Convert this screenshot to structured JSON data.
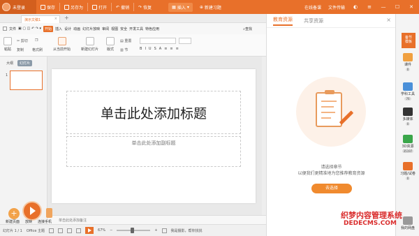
{
  "titlebar": {
    "login": "未登录",
    "save": "保存",
    "save_as": "另存为",
    "open": "打开",
    "undo": "撤销",
    "redo": "恢复",
    "insert": "插入",
    "new_course": "新建习题",
    "online_course": "在线备课",
    "file_transfer": "文件传输"
  },
  "tabstrip": {
    "doc_tab": "演示文稿1",
    "add": "+"
  },
  "menurow": {
    "file": "文件",
    "start": "开始",
    "items": [
      "插入",
      "设计",
      "动画",
      "幻灯片放映",
      "审阅",
      "视图",
      "安全",
      "开发工具",
      "特色应用"
    ],
    "search": "查找"
  },
  "ribbon": {
    "paste": "粘贴",
    "cut": "剪切",
    "copy": "复制",
    "format_painter": "格式刷",
    "from_current": "从当前开始",
    "new_slide": "新建幻灯片",
    "layout": "版式",
    "reset": "重置",
    "section": "节"
  },
  "leftpanel": {
    "tab_outline": "大纲",
    "tab_slides": "幻灯片",
    "slide_number": "1"
  },
  "slide": {
    "title_placeholder": "单击此处添加标题",
    "subtitle_placeholder": "单击此处添加副标题"
  },
  "notes": "单击此处添加备注",
  "floating": {
    "new_page": "新建页面",
    "play": "放映",
    "phone": "连接手机"
  },
  "statusbar": {
    "slide_info": "幻灯片 1 / 1",
    "theme": "Office 主题",
    "zoom": "67%",
    "assistant": "我是摄影，帮你找找"
  },
  "rightpanel": {
    "tab_edu": "教育资源",
    "tab_share": "共享资源",
    "tip1": "请选择章节",
    "tip2": "以便我们更精准地为您推荐教育资源",
    "choose_button": "去选择"
  },
  "rightbar": {
    "top": "备节\n模板",
    "items": [
      {
        "label": "课件",
        "count": "0",
        "color": "#f0a040"
      },
      {
        "label": "学科工具",
        "count": "76",
        "color": "#4a90d9"
      },
      {
        "label": "多媒体",
        "count": "0",
        "color": "#333333"
      },
      {
        "label": "3D资源",
        "count": "35197",
        "color": "#3aa64a"
      },
      {
        "label": "习题/试卷",
        "count": "0",
        "color": "#e8702a"
      },
      {
        "label": "我的网盘",
        "count": "",
        "color": "#999999"
      }
    ]
  },
  "watermark": {
    "line1": "织梦内容管理系统",
    "line2": "DEDECMS.COM"
  },
  "colors": {
    "accent": "#e8702a",
    "button": "#f08a2e"
  }
}
